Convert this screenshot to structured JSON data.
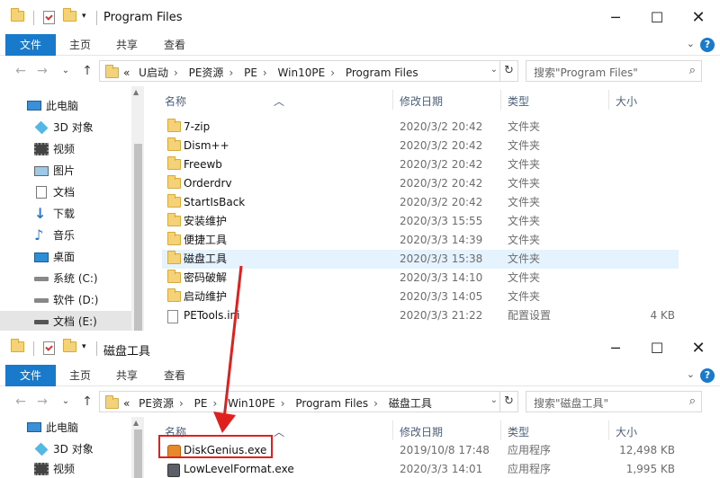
{
  "window1": {
    "title": "Program Files",
    "ribbon_tabs": [
      "文件",
      "主页",
      "共享",
      "查看"
    ],
    "breadcrumb": [
      "«",
      "U启动",
      "PE资源",
      "PE",
      "Win10PE",
      "Program Files"
    ],
    "search_placeholder": "搜索\"Program Files\"",
    "nav": [
      {
        "label": "此电脑",
        "icon": "pc-icon"
      },
      {
        "label": "3D 对象",
        "icon": "cube-icon"
      },
      {
        "label": "视频",
        "icon": "video-icon"
      },
      {
        "label": "图片",
        "icon": "picture-icon"
      },
      {
        "label": "文档",
        "icon": "document-icon"
      },
      {
        "label": "下载",
        "icon": "download-icon"
      },
      {
        "label": "音乐",
        "icon": "music-icon"
      },
      {
        "label": "桌面",
        "icon": "desktop-icon"
      },
      {
        "label": "系统 (C:)",
        "icon": "drive-icon"
      },
      {
        "label": "软件 (D:)",
        "icon": "drive-icon"
      },
      {
        "label": "文档 (E:)",
        "icon": "drive-icon"
      }
    ],
    "columns": {
      "name": "名称",
      "date": "修改日期",
      "type": "类型",
      "size": "大小"
    },
    "files": [
      {
        "name": "7-zip",
        "date": "2020/3/2 20:42",
        "type": "文件夹",
        "size": ""
      },
      {
        "name": "Dism++",
        "date": "2020/3/2 20:42",
        "type": "文件夹",
        "size": ""
      },
      {
        "name": "Freewb",
        "date": "2020/3/2 20:42",
        "type": "文件夹",
        "size": ""
      },
      {
        "name": "Orderdrv",
        "date": "2020/3/2 20:42",
        "type": "文件夹",
        "size": ""
      },
      {
        "name": "StartIsBack",
        "date": "2020/3/2 20:42",
        "type": "文件夹",
        "size": ""
      },
      {
        "name": "安装维护",
        "date": "2020/3/3 15:55",
        "type": "文件夹",
        "size": ""
      },
      {
        "name": "便捷工具",
        "date": "2020/3/3 14:39",
        "type": "文件夹",
        "size": ""
      },
      {
        "name": "磁盘工具",
        "date": "2020/3/3 15:38",
        "type": "文件夹",
        "size": ""
      },
      {
        "name": "密码破解",
        "date": "2020/3/3 14:10",
        "type": "文件夹",
        "size": ""
      },
      {
        "name": "启动维护",
        "date": "2020/3/3 14:05",
        "type": "文件夹",
        "size": ""
      },
      {
        "name": "PETools.ini",
        "date": "2020/3/3 21:22",
        "type": "配置设置",
        "size": "4 KB"
      }
    ]
  },
  "window2": {
    "title": "磁盘工具",
    "ribbon_tabs": [
      "文件",
      "主页",
      "共享",
      "查看"
    ],
    "breadcrumb": [
      "«",
      "PE资源",
      "PE",
      "Win10PE",
      "Program Files",
      "磁盘工具"
    ],
    "search_placeholder": "搜索\"磁盘工具\"",
    "nav": [
      {
        "label": "此电脑",
        "icon": "pc-icon"
      },
      {
        "label": "3D 对象",
        "icon": "cube-icon"
      },
      {
        "label": "视频",
        "icon": "video-icon"
      }
    ],
    "columns": {
      "name": "名称",
      "date": "修改日期",
      "type": "类型",
      "size": "大小"
    },
    "files": [
      {
        "name": "DiskGenius.exe",
        "date": "2019/10/8 17:48",
        "type": "应用程序",
        "size": "12,498 KB"
      },
      {
        "name": "LowLevelFormat.exe",
        "date": "2020/3/3 14:01",
        "type": "应用程序",
        "size": "1,995 KB"
      }
    ]
  },
  "colors": {
    "accent": "#1979ca",
    "selected_row": "#e5f3ff",
    "annotation_red": "#e01f1f"
  }
}
